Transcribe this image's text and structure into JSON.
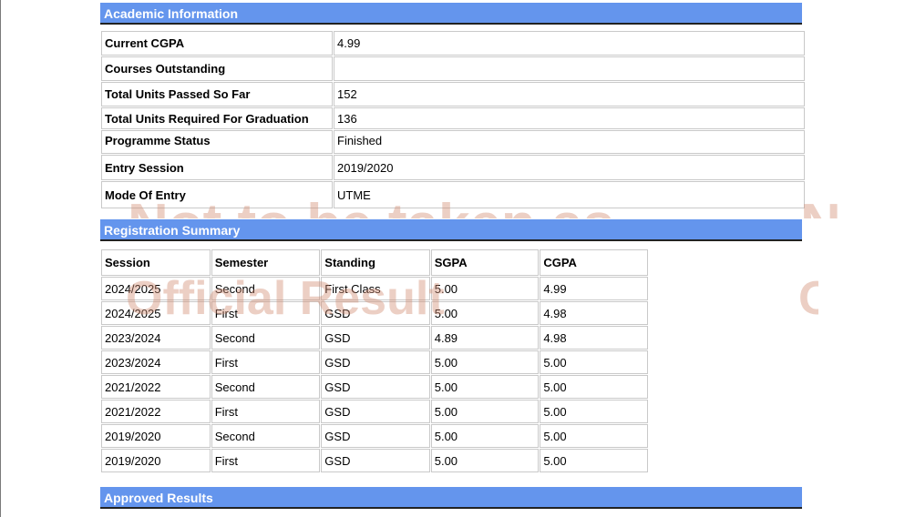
{
  "academic_info": {
    "title": "Academic Information",
    "rows": [
      {
        "label": "Current CGPA",
        "value": "4.99"
      },
      {
        "label": "Courses Outstanding",
        "value": ""
      },
      {
        "label": "Total Units Passed So Far",
        "value": "152"
      },
      {
        "label": "Total Units Required For Graduation",
        "value": "136"
      },
      {
        "label": "Programme Status",
        "value": "Finished"
      },
      {
        "label": "Entry Session",
        "value": "2019/2020"
      },
      {
        "label": "Mode Of Entry",
        "value": "UTME"
      }
    ]
  },
  "registration_summary": {
    "title": "Registration Summary",
    "columns": [
      "Session",
      "Semester",
      "Standing",
      "SGPA",
      "CGPA"
    ],
    "rows": [
      [
        "2024/2025",
        "Second",
        "First Class",
        "5.00",
        "4.99"
      ],
      [
        "2024/2025",
        "First",
        "GSD",
        "5.00",
        "4.98"
      ],
      [
        "2023/2024",
        "Second",
        "GSD",
        "4.89",
        "4.98"
      ],
      [
        "2023/2024",
        "First",
        "GSD",
        "5.00",
        "5.00"
      ],
      [
        "2021/2022",
        "Second",
        "GSD",
        "5.00",
        "5.00"
      ],
      [
        "2021/2022",
        "First",
        "GSD",
        "5.00",
        "5.00"
      ],
      [
        "2019/2020",
        "Second",
        "GSD",
        "5.00",
        "5.00"
      ],
      [
        "2019/2020",
        "First",
        "GSD",
        "5.00",
        "5.00"
      ]
    ]
  },
  "approved_results": {
    "title": "Approved Results"
  },
  "watermark": {
    "line1": "Not to be taken as",
    "line2": "Official Result",
    "line1_right": "N",
    "line2_right": "O"
  }
}
